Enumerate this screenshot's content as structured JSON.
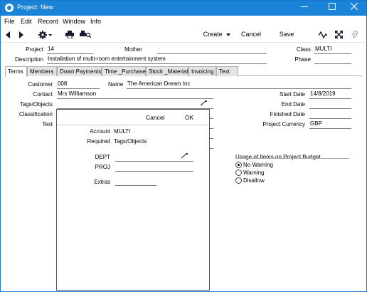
{
  "window": {
    "title": "Project: New",
    "controls": [
      "minimize-icon",
      "maximize-icon",
      "close-icon"
    ]
  },
  "menu": [
    "File",
    "Edit",
    "Record",
    "Window",
    "Info"
  ],
  "toolbar": {
    "create": "Create",
    "cancel": "Cancel",
    "save": "Save"
  },
  "header": {
    "project_label": "Project",
    "project_value": "14",
    "mother_label": "Mother",
    "mother_value": "",
    "class_label": "Class",
    "class_value": "MULTI",
    "description_label": "Description",
    "description_value": "Installation of multi-room entertainment system",
    "phase_label": "Phase",
    "phase_value": ""
  },
  "tabs": [
    "Terms",
    "Members",
    "Down Payments",
    "Time _Purchases",
    "Stock _Materials",
    "Invoicing",
    "Text"
  ],
  "terms": {
    "customer_label": "Customer",
    "customer_value": "008",
    "name_label": "Name",
    "name_value": "The American Dream Inc",
    "contact_label": "Contact",
    "contact_value": "Mrs Williamson",
    "tags_label": "Tags/Objects",
    "classification_label": "Classification",
    "text_label": "Text",
    "start_date_label": "Start Date",
    "start_date_value": "14/8/2019",
    "end_date_label": "End Date",
    "end_date_value": "",
    "finished_date_label": "Finished Date",
    "finished_date_value": "",
    "currency_label": "Project Currency",
    "currency_value": "GBP",
    "usage_label": "Usage of Items on Project Budget",
    "usage_options": [
      "No Warning",
      "Warning",
      "Disallow"
    ],
    "usage_selected": "No Warning"
  },
  "popup": {
    "cancel": "Cancel",
    "ok": "OK",
    "account_label": "Account",
    "account_value": "MULTI",
    "required_label": "Required",
    "required_value": "Tags/Objects",
    "dept_label": "DEPT",
    "dept_value": "",
    "proj_label": "PROJ",
    "proj_value": "",
    "extras_label": "Extras",
    "extras_value": ""
  }
}
